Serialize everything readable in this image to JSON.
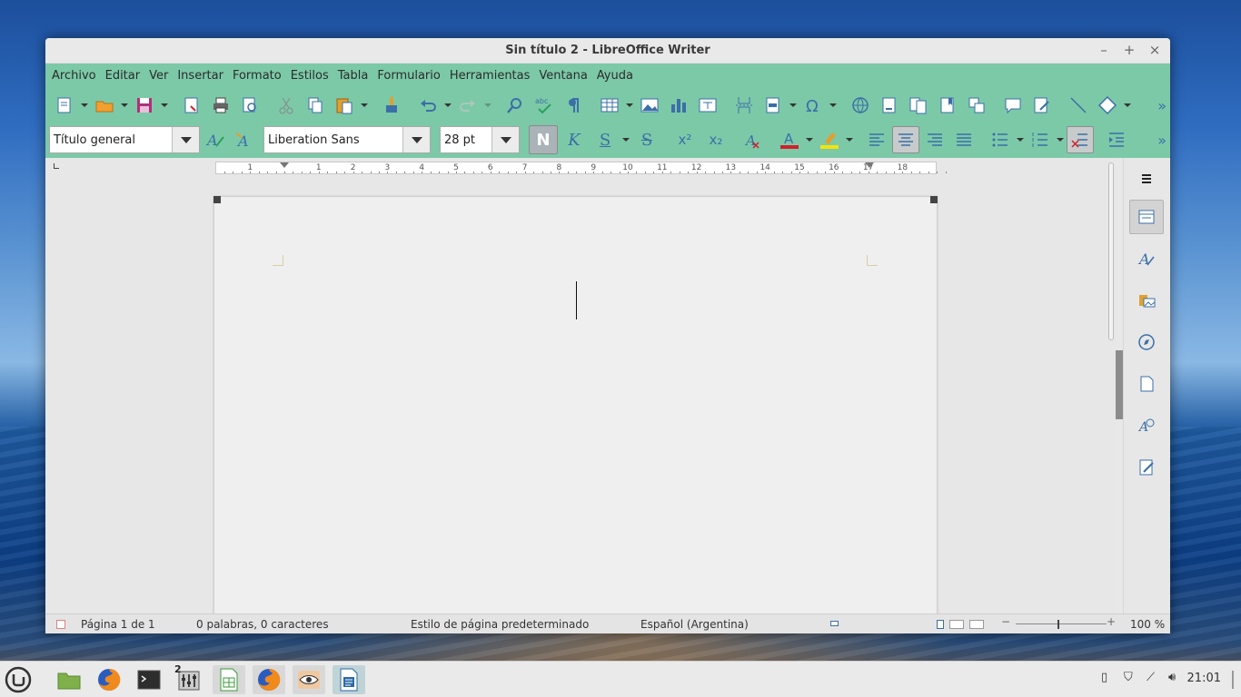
{
  "window": {
    "title": "Sin título 2 - LibreOffice Writer",
    "controls": {
      "minimize": "–",
      "maximize": "+",
      "close": "×"
    }
  },
  "menu": [
    "Archivo",
    "Editar",
    "Ver",
    "Insertar",
    "Formato",
    "Estilos",
    "Tabla",
    "Formulario",
    "Herramientas",
    "Ventana",
    "Ayuda"
  ],
  "formatting": {
    "paragraph_style": "Título general",
    "font_name": "Liberation Sans",
    "font_size": "28 pt",
    "bold_label": "N",
    "italic_label": "K",
    "underline_label": "S",
    "strike_label": "S",
    "superscript_label": "x²",
    "subscript_label": "x₂"
  },
  "ruler": {
    "labels": [
      "1",
      "1",
      "2",
      "3",
      "4",
      "5",
      "6",
      "7",
      "8",
      "9",
      "10",
      "11",
      "12",
      "13",
      "14",
      "15",
      "16",
      "17",
      "18"
    ]
  },
  "status": {
    "page": "Página 1 de 1",
    "words": "0 palabras, 0 caracteres",
    "page_style": "Estilo de página predeterminado",
    "language": "Español (Argentina)",
    "zoom": "100 %"
  },
  "taskbar": {
    "workspace_badge": "2",
    "clock": "21:01"
  },
  "colors": {
    "toolbar_green": "#7cc9a8",
    "icon_blue": "#3b6fa7",
    "font_color_red": "#d1202a",
    "highlight_yellow": "#f4e40a"
  }
}
